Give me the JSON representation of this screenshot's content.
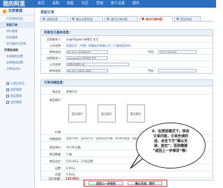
{
  "topnav": {
    "logo": "我的阿里",
    "menu": [
      "首页",
      "采购",
      "销售",
      "社区",
      "营销",
      "账户设置",
      "服务"
    ]
  },
  "sidebar": {
    "title": "交易管理",
    "items": [
      {
        "label": "已买到的货品"
      },
      {
        "label": "发起订单"
      },
      {
        "label": "评价管理"
      },
      {
        "label": "投诉管理"
      },
      {
        "label": "求为我的订货单"
      },
      {
        "label": "交易加油站"
      },
      {
        "label": "交易服务设置"
      },
      {
        "label": "交易物流设置"
      },
      {
        "label": "订单自动化"
      },
      {
        "label": "已卖出货品"
      },
      {
        "label": "卖家管理"
      },
      {
        "label": "商品管理"
      },
      {
        "label": "会员管理"
      }
    ]
  },
  "page": {
    "title": "发起订单"
  },
  "steps": [
    {
      "label": "选择买家"
    },
    {
      "label": "确认买家信息"
    },
    {
      "label": "填写订单内容"
    },
    {
      "label": "核对订单内容"
    },
    {
      "label": "提交完成"
    }
  ],
  "buyer_section": {
    "title": "买家双方基本信息：",
    "rows": [
      {
        "label": "买家联系人：",
        "value": "alijqfsdjqwd  林德信  先生"
      },
      {
        "label": "公司名称：",
        "value": "阿里巴巴（中国）网络技术有限公司（六星电话同号）"
      },
      {
        "label": "联系电话：",
        "value": "86-0571-85688187",
        "label2": "手机：",
        "value2": "13771784435"
      },
      {
        "label": "卖家联系人：",
        "value": "xenowwl525  陈加斌  先生"
      },
      {
        "label": "公司名称：",
        "value": "林德信有限公司"
      },
      {
        "label": "联系电话：",
        "value": "86-0571-88814586",
        "label2": "手机：",
        "value2": ""
      }
    ]
  },
  "order_section": {
    "title": "订单详细信息：",
    "rows": [
      {
        "label": "商品名：",
        "value": "原装打印"
      },
      {
        "label": "商品图片：",
        "images": [
          "暂无图片",
          "暂无图片",
          "暂无图片"
        ]
      },
      {
        "label": "价格：",
        "value": ""
      },
      {
        "label": "货物说明：",
        "value": "原装打印机，高标准打印，品质保证有问题，请先联系客服，谢谢光临"
      },
      {
        "label": "商品单价：",
        "value": "50.00元/箱"
      },
      {
        "label": "购买数量：",
        "value": "5 箱"
      },
      {
        "label": "商品总价：",
        "value": "250.00元（不含运费）"
      },
      {
        "label": "运费：",
        "value": "0.00元"
      },
      {
        "label": "优惠：",
        "value": "0.00元"
      },
      {
        "label": "实付金额：",
        "value": "250.00元"
      }
    ]
  },
  "callout": {
    "text": "6、在预览模式下，核对\n订单内容，订单无误的\n话，点击下方“确认无\n误，提交”，否则需要\n“返回上一步修改”哦！"
  },
  "footer": {
    "back_label": "返回上一步修改",
    "confirm_label": "确认无误，提交"
  }
}
